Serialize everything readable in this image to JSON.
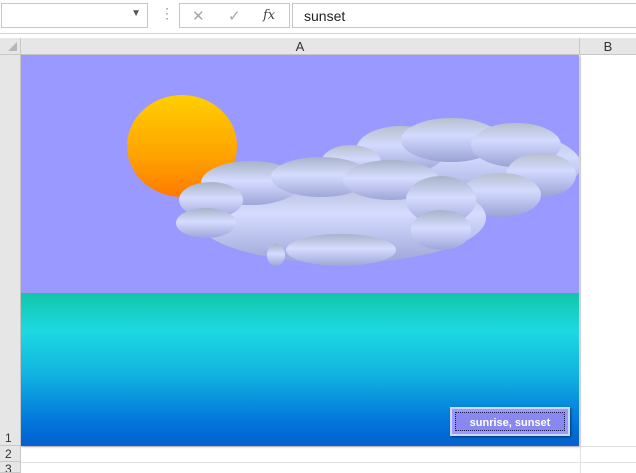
{
  "formula_bar": {
    "name_box_value": "",
    "cancel_glyph": "✕",
    "enter_glyph": "✓",
    "function_glyph": "fx",
    "formula_value": "sunset"
  },
  "columns": [
    {
      "label": "A"
    },
    {
      "label": "B"
    }
  ],
  "rows": [
    {
      "label": "1"
    },
    {
      "label": "2"
    },
    {
      "label": "3"
    }
  ],
  "scene": {
    "sky_color": "#9999ff",
    "sun_colors": [
      "#ffd000",
      "#ff8a00"
    ],
    "cloud_color": "#cdd5ff",
    "sea_colors": [
      "#12c6aa",
      "#1dd9e1",
      "#0377dd"
    ],
    "button_label": "sunrise, sunset"
  }
}
